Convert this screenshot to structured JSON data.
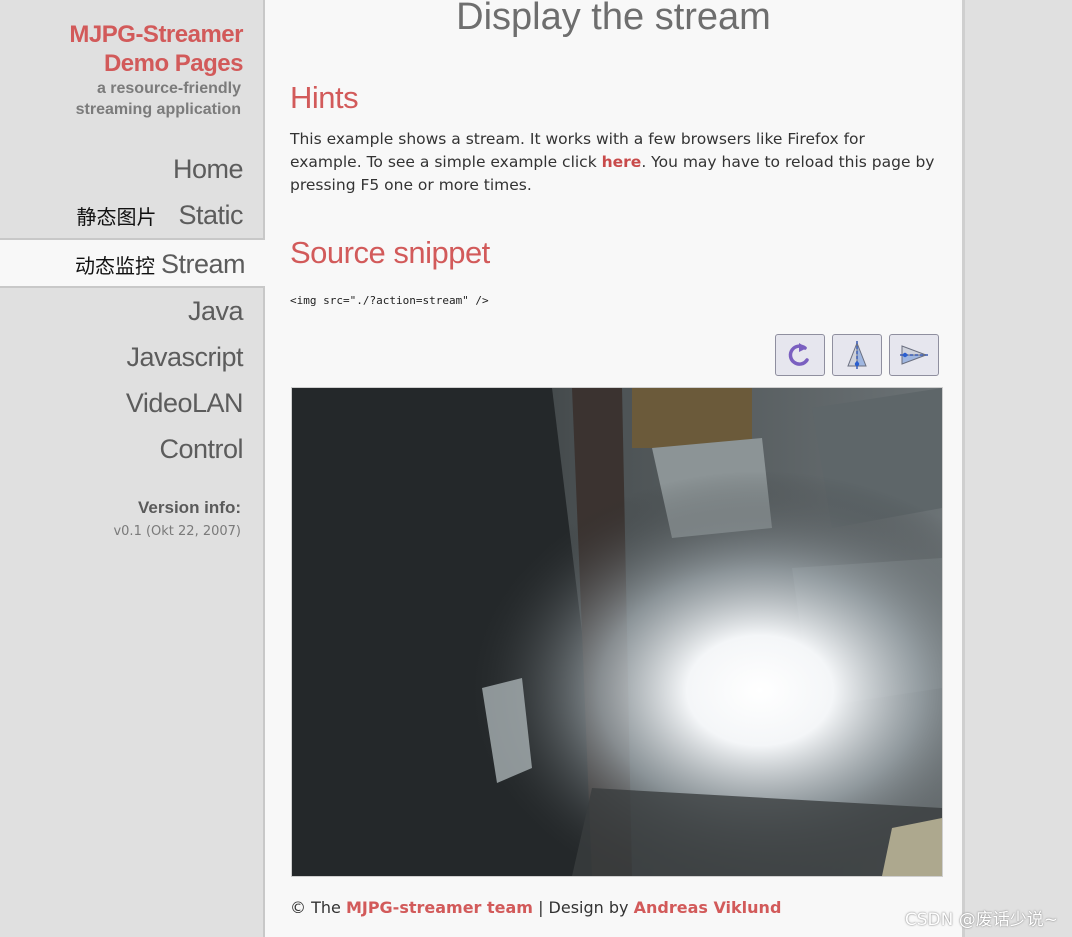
{
  "sidebar": {
    "logo_line1": "MJPG-Streamer",
    "logo_line2": "Demo Pages",
    "tagline_line1": "a resource-friendly",
    "tagline_line2": "streaming application",
    "nav": [
      {
        "label": "Home",
        "cn": ""
      },
      {
        "label": "Static",
        "cn": "静态图片"
      },
      {
        "label": "Stream",
        "cn": "动态监控",
        "active": true
      },
      {
        "label": "Java",
        "cn": ""
      },
      {
        "label": "Javascript",
        "cn": ""
      },
      {
        "label": "VideoLAN",
        "cn": ""
      },
      {
        "label": "Control",
        "cn": ""
      }
    ],
    "version_heading": "Version info:",
    "version_text": "v0.1 (Okt 22, 2007)"
  },
  "main": {
    "title": "Display the stream",
    "hints_heading": "Hints",
    "hints_before": "This example shows a stream. It works with a few browsers like Firefox for example. To see a simple example click ",
    "hints_link": "here",
    "hints_after": ". You may have to reload this page by pressing F5 one or more times.",
    "snippet_heading": "Source snippet",
    "snippet_code": "<img src=\"./?action=stream\" />",
    "tools": [
      {
        "name": "rotate",
        "icon": "rotate-icon"
      },
      {
        "name": "flip-vertical",
        "icon": "flip-vertical-icon"
      },
      {
        "name": "flip-horizontal",
        "icon": "flip-horizontal-icon"
      }
    ]
  },
  "footer": {
    "prefix": "© The ",
    "team_link": "MJPG-streamer team",
    "sep": " | Design by ",
    "designer_link": "Andreas Viklund"
  },
  "watermark": "CSDN @废话少说~",
  "colors": {
    "accent": "#d25a5a",
    "sidebar_bg": "#e0e0e0",
    "content_bg": "#f8f8f8"
  }
}
